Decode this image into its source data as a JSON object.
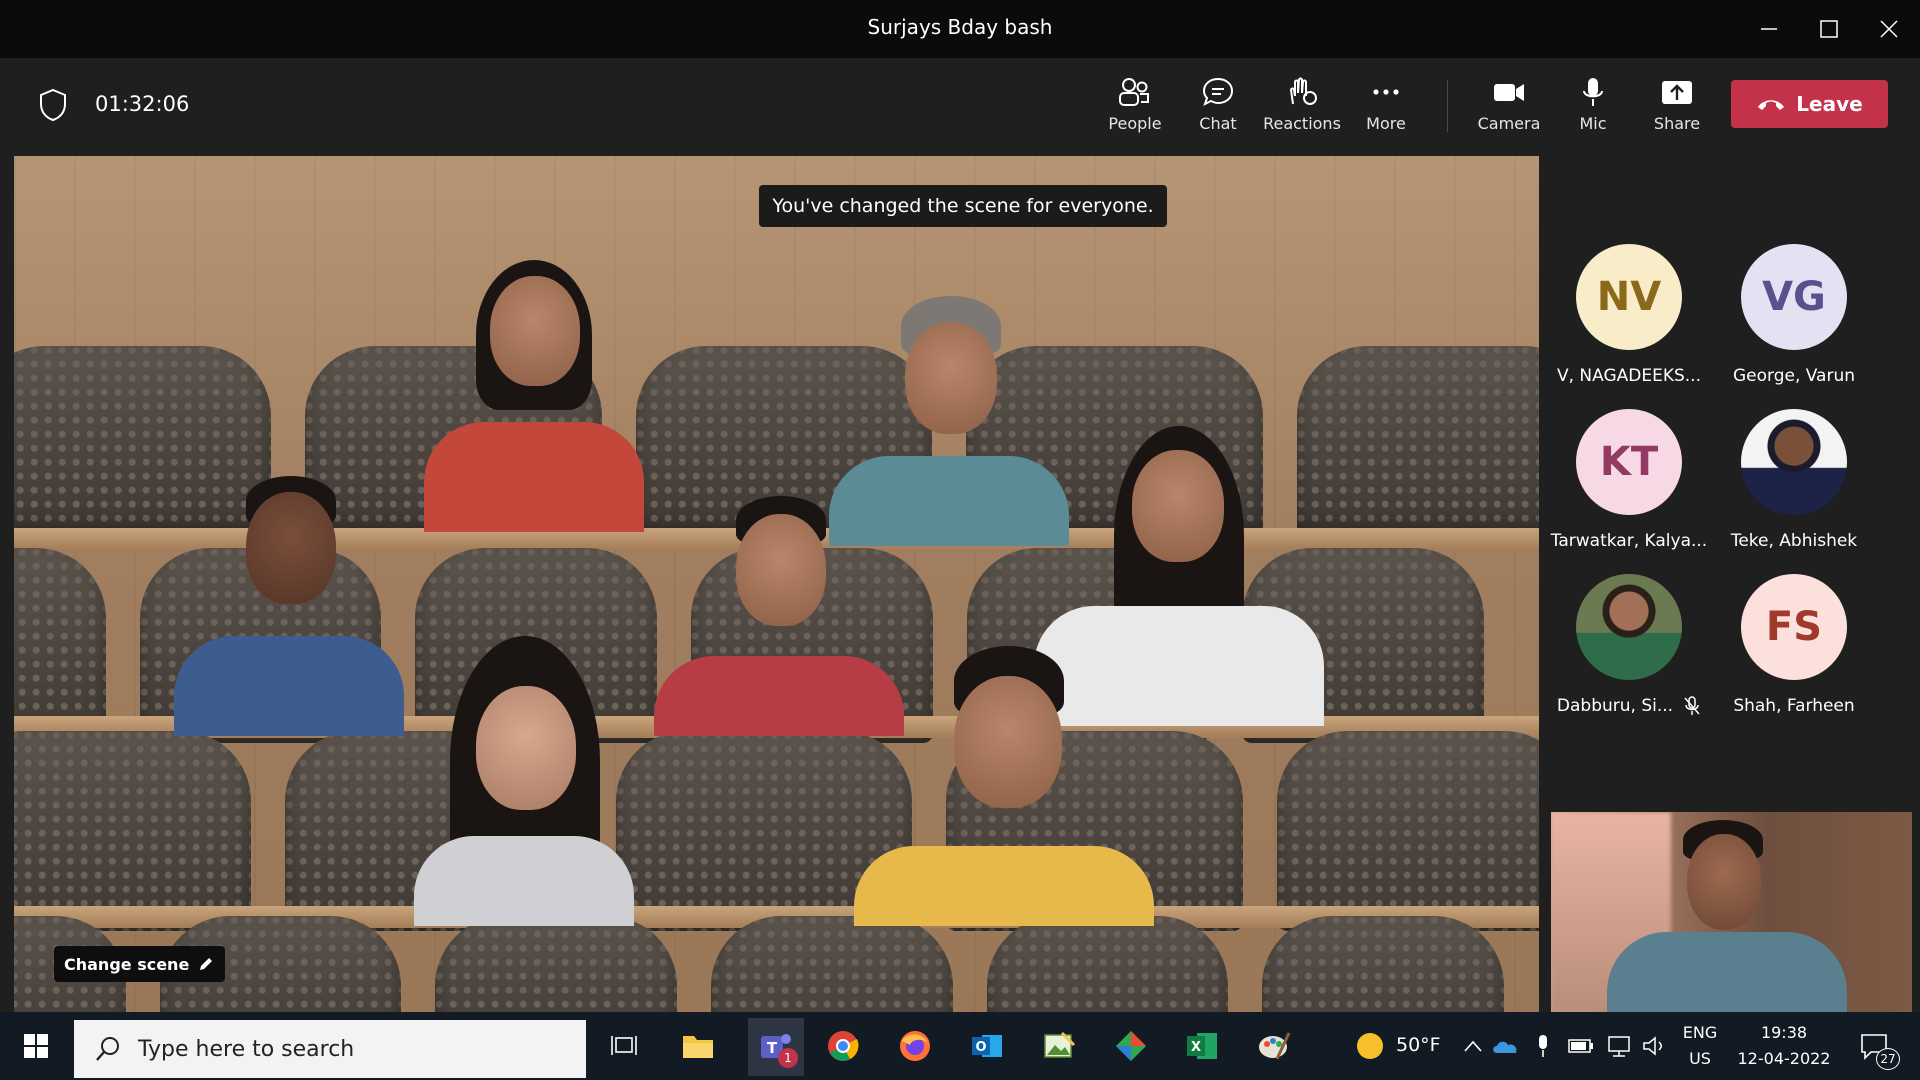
{
  "window": {
    "title": "Surjays Bday bash"
  },
  "toolbar": {
    "timer": "01:32:06",
    "buttons": [
      {
        "label": "People",
        "icon": "people-icon"
      },
      {
        "label": "Chat",
        "icon": "chat-icon"
      },
      {
        "label": "Reactions",
        "icon": "reactions-icon"
      },
      {
        "label": "More",
        "icon": "more-icon"
      },
      {
        "label": "Camera",
        "icon": "camera-icon"
      },
      {
        "label": "Mic",
        "icon": "mic-icon"
      },
      {
        "label": "Share",
        "icon": "share-icon"
      }
    ],
    "leave_label": "Leave",
    "leave_color": "#c4314b"
  },
  "stage": {
    "banner": "You've changed the scene for everyone.",
    "change_scene_label": "Change scene"
  },
  "participants": [
    {
      "initials": "NV",
      "name": "V, NAGADEEKS...",
      "avatar_bg": "#f8ecc9",
      "avatar_fg": "#8a6a1a",
      "muted": false
    },
    {
      "initials": "VG",
      "name": "George, Varun",
      "avatar_bg": "#e5e1f2",
      "avatar_fg": "#5b4f8d",
      "muted": false
    },
    {
      "initials": "KT",
      "name": "Tarwatkar, Kalya...",
      "avatar_bg": "#f7d9e6",
      "avatar_fg": "#943a62",
      "muted": false
    },
    {
      "initials": "",
      "name": "Teke, Abhishek",
      "photo": true,
      "muted": false
    },
    {
      "initials": "",
      "name": "Dabburu, Si...",
      "photo": true,
      "muted": true
    },
    {
      "initials": "FS",
      "name": "Shah, Farheen",
      "avatar_bg": "#fbe0dc",
      "avatar_fg": "#a03a2c",
      "muted": false
    }
  ],
  "taskbar": {
    "search_placeholder": "Type here to search",
    "teams_badge": "1",
    "weather": "50°F",
    "lang_top": "ENG",
    "lang_bottom": "US",
    "time": "19:38",
    "date": "12-04-2022",
    "notifications": "27"
  }
}
